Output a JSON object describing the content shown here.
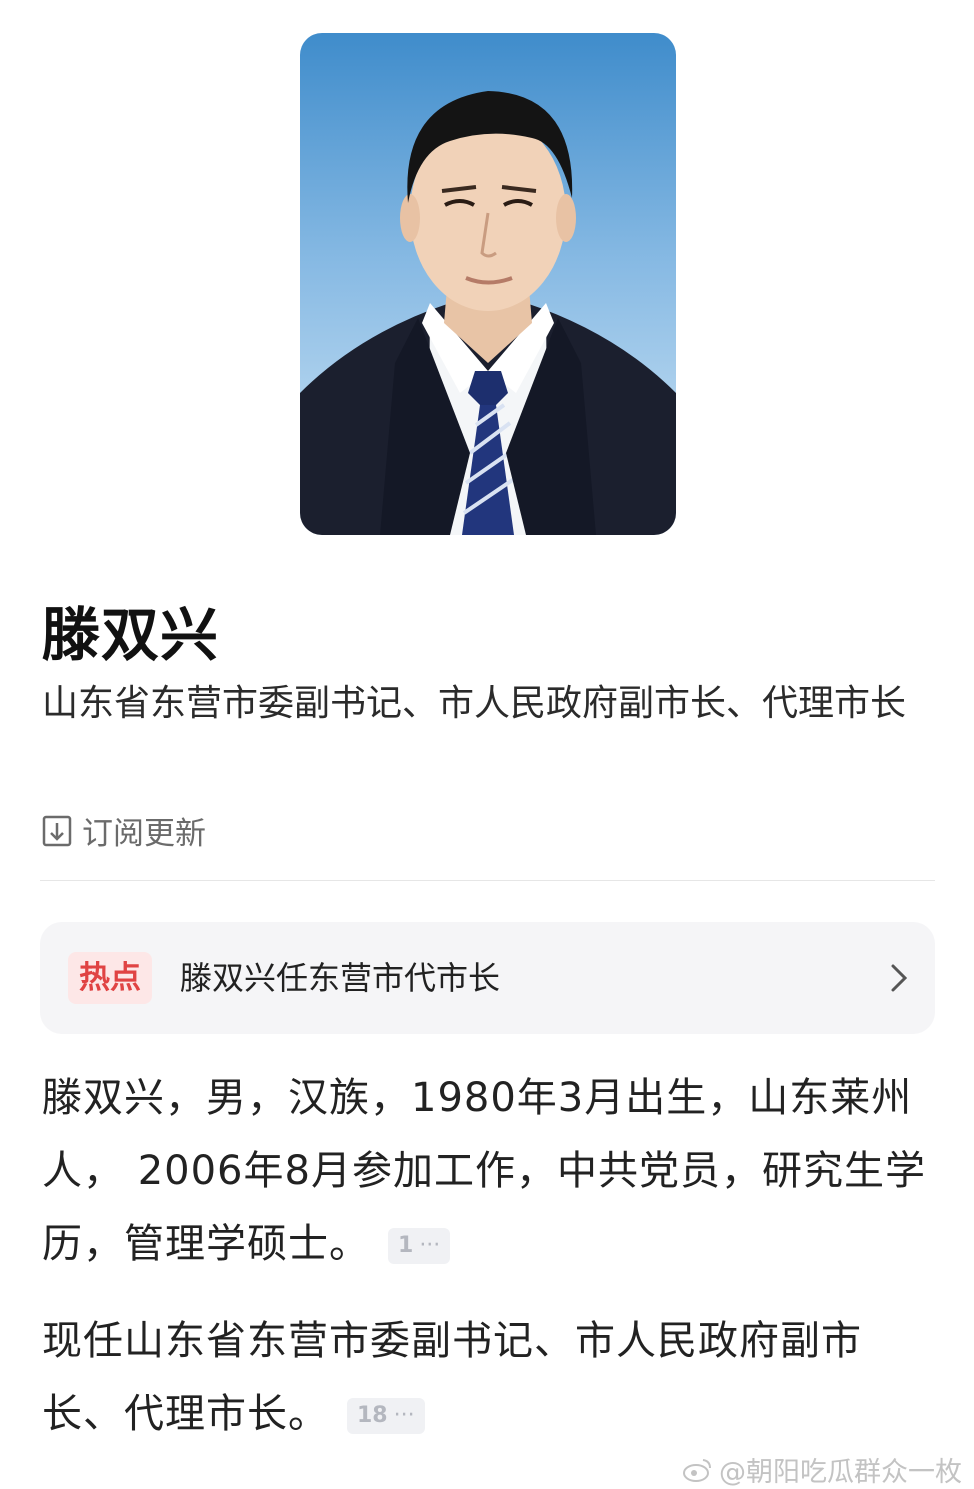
{
  "profile": {
    "name": "滕双兴",
    "title": "山东省东营市委副书记、市人民政府副市长、代理市长",
    "subscribe_label": "订阅更新"
  },
  "hot": {
    "tag": "热点",
    "text": "滕双兴任东营市代市长"
  },
  "bio": {
    "paragraph1": "滕双兴，男，汉族，1980年3月出生，山东莱州人， 2006年8月参加工作，中共党员，研究生学历，管理学硕士。",
    "ref1": "1",
    "paragraph2": "现任山东省东营市委副书记、市人民政府副市长、代理市长。",
    "ref2": "18",
    "ref_more": "···"
  },
  "watermark": {
    "text": "@朝阳吃瓜群众一枚",
    "icon": "weibo-icon"
  },
  "colors": {
    "hot_tag_bg": "#fde7e7",
    "hot_tag_text": "#e04343",
    "card_bg": "#f5f5f7"
  }
}
